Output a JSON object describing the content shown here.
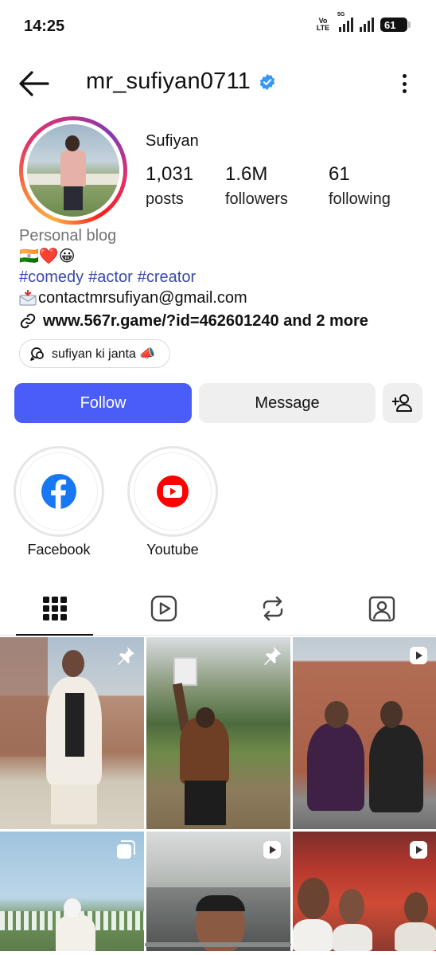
{
  "status_bar": {
    "time": "14:25",
    "network_tag": "Vo LTE",
    "signal_tag": "5G",
    "battery": "61"
  },
  "header": {
    "username": "mr_sufiyan0711",
    "verified": true,
    "back_icon": "arrow-left-icon",
    "more_icon": "more-vertical-icon"
  },
  "profile": {
    "display_name": "Sufiyan",
    "stats": {
      "posts_count": "1,031",
      "posts_label": "posts",
      "followers_count": "1.6M",
      "followers_label": "followers",
      "following_count": "61",
      "following_label": "following"
    }
  },
  "bio": {
    "category": "Personal blog",
    "emoji_line": "🇮🇳❤️😀",
    "hashtags": [
      "#comedy",
      "#actor",
      "#creator"
    ],
    "email": "contactmrsufiyan@gmail.com",
    "link": "www.567r.game/?id=462601240 and 2 more"
  },
  "thread_chip": {
    "label": "sufiyan ki janta 📣"
  },
  "actions": {
    "follow_label": "Follow",
    "message_label": "Message",
    "add_icon": "add-person-icon"
  },
  "highlights": [
    {
      "label": "Facebook",
      "icon": "facebook-icon"
    },
    {
      "label": "Youtube",
      "icon": "youtube-icon"
    }
  ],
  "tabs": [
    {
      "icon": "grid-icon",
      "active": true
    },
    {
      "icon": "reels-icon",
      "active": false
    },
    {
      "icon": "reposts-icon",
      "active": false
    },
    {
      "icon": "tagged-icon",
      "active": false
    }
  ],
  "posts": [
    {
      "badge": "pin-icon"
    },
    {
      "badge": "pin-icon"
    },
    {
      "badge": "reel-icon"
    },
    {
      "badge": "carousel-icon"
    },
    {
      "badge": "reel-icon"
    },
    {
      "badge": "reel-icon"
    }
  ],
  "colors": {
    "follow_button": "#4a5df9",
    "hashtag": "#3949ab",
    "verified": "#3897f0",
    "facebook": "#1877f2",
    "youtube": "#ff0000"
  }
}
